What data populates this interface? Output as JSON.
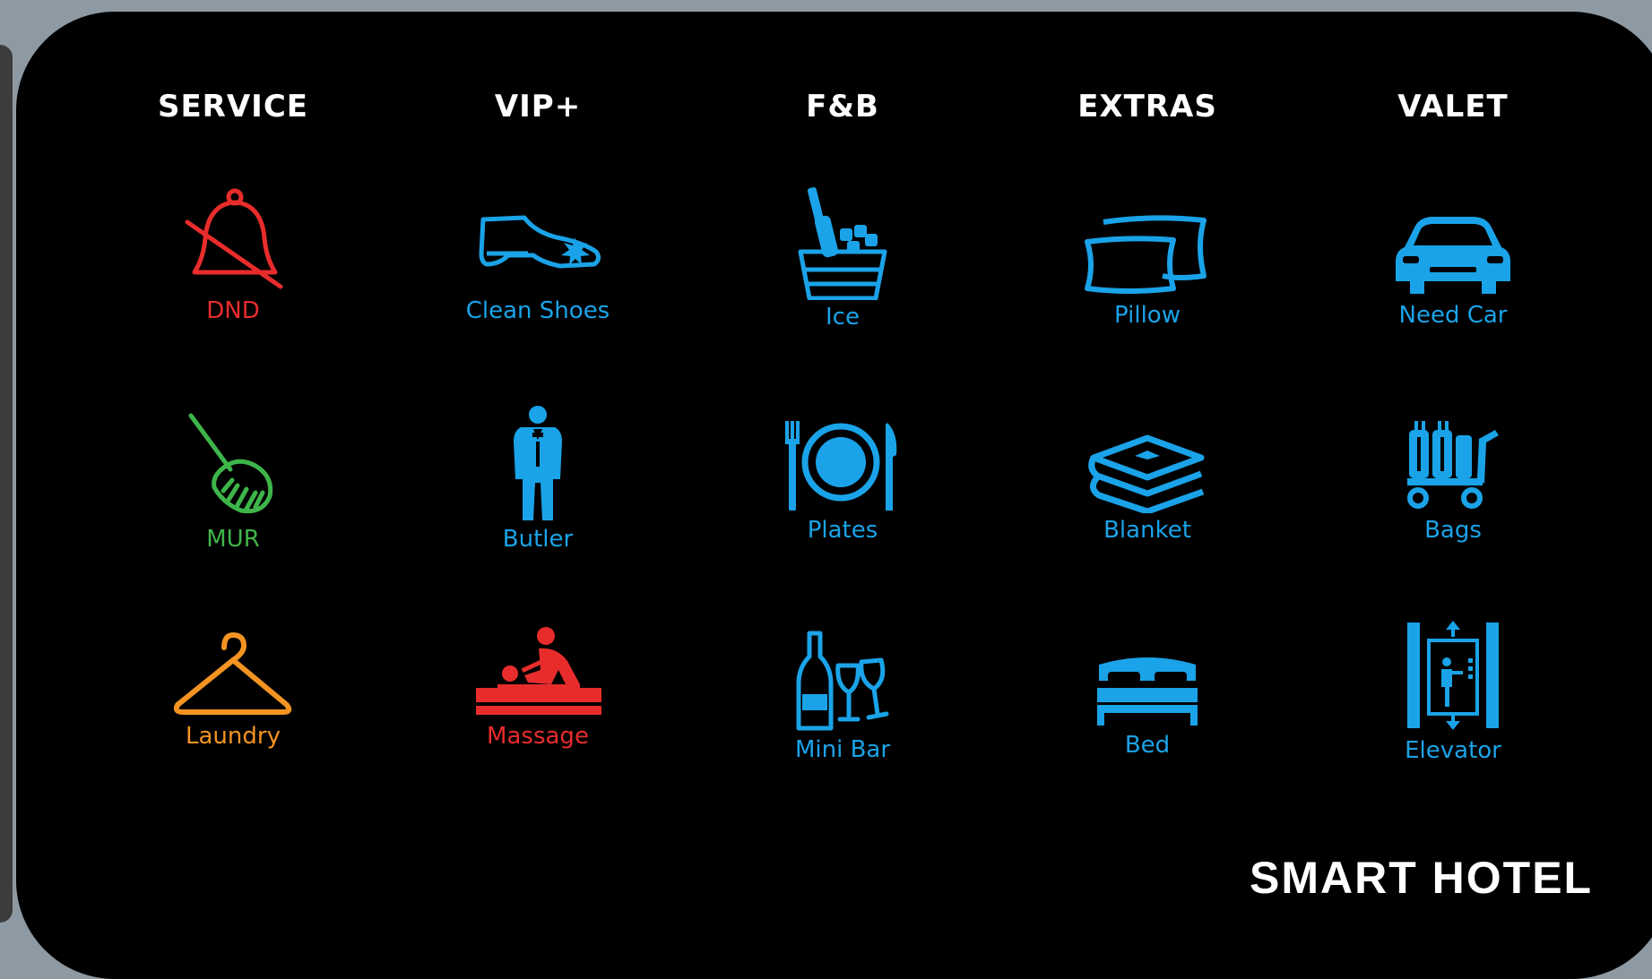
{
  "columns": [
    "SERVICE",
    "VIP+",
    "F&B",
    "EXTRAS",
    "VALET"
  ],
  "colors": {
    "red": "#e82c2c",
    "green": "#3eb54a",
    "orange": "#f39322",
    "blue": "#1aa3e8",
    "white": "#ffffff",
    "background": "#000000"
  },
  "tiles": {
    "dnd": {
      "label": "DND",
      "icon": "bell-off-icon",
      "color": "#e82c2c"
    },
    "clean_shoes": {
      "label": "Clean Shoes",
      "icon": "shoe-icon",
      "color": "#1aa3e8"
    },
    "ice": {
      "label": "Ice",
      "icon": "ice-bucket-icon",
      "color": "#1aa3e8"
    },
    "pillow": {
      "label": "Pillow",
      "icon": "pillow-icon",
      "color": "#1aa3e8"
    },
    "need_car": {
      "label": "Need Car",
      "icon": "car-icon",
      "color": "#1aa3e8"
    },
    "mur": {
      "label": "MUR",
      "icon": "broom-icon",
      "color": "#3eb54a"
    },
    "butler": {
      "label": "Butler",
      "icon": "butler-icon",
      "color": "#1aa3e8"
    },
    "plates": {
      "label": "Plates",
      "icon": "plate-cutlery-icon",
      "color": "#1aa3e8"
    },
    "blanket": {
      "label": "Blanket",
      "icon": "blanket-icon",
      "color": "#1aa3e8"
    },
    "bags": {
      "label": "Bags",
      "icon": "luggage-cart-icon",
      "color": "#1aa3e8"
    },
    "laundry": {
      "label": "Laundry",
      "icon": "hanger-icon",
      "color": "#f39322"
    },
    "massage": {
      "label": "Massage",
      "icon": "massage-icon",
      "color": "#e82c2c"
    },
    "mini_bar": {
      "label": "Mini Bar",
      "icon": "wine-glasses-icon",
      "color": "#1aa3e8"
    },
    "bed": {
      "label": "Bed",
      "icon": "bed-icon",
      "color": "#1aa3e8"
    },
    "elevator": {
      "label": "Elevator",
      "icon": "elevator-icon",
      "color": "#1aa3e8"
    }
  },
  "brand": "SMART HOTEL"
}
